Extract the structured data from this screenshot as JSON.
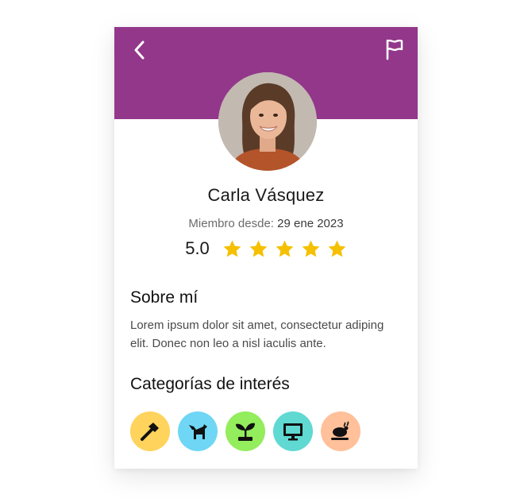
{
  "profile": {
    "name": "Carla Vásquez",
    "member_label": "Miembro desde:",
    "member_date": "29 ene 2023",
    "rating": "5.0",
    "stars": 5
  },
  "about": {
    "title": "Sobre mí",
    "text": "Lorem ipsum dolor sit amet, consectetur adiping elit. Donec non leo a nisl iaculis ante."
  },
  "categories": {
    "title": "Categorías de interés",
    "items": [
      {
        "icon": "hammer-icon",
        "color": "#ffd35c"
      },
      {
        "icon": "dog-icon",
        "color": "#6fd6f5"
      },
      {
        "icon": "plant-icon",
        "color": "#93ed5c"
      },
      {
        "icon": "monitor-icon",
        "color": "#5fd9d2"
      },
      {
        "icon": "roast-chicken-icon",
        "color": "#ffc09a"
      }
    ]
  },
  "colors": {
    "header": "#93378b",
    "star": "#f5c000"
  },
  "header": {
    "back_icon": "chevron-left-icon",
    "flag_icon": "flag-icon"
  }
}
